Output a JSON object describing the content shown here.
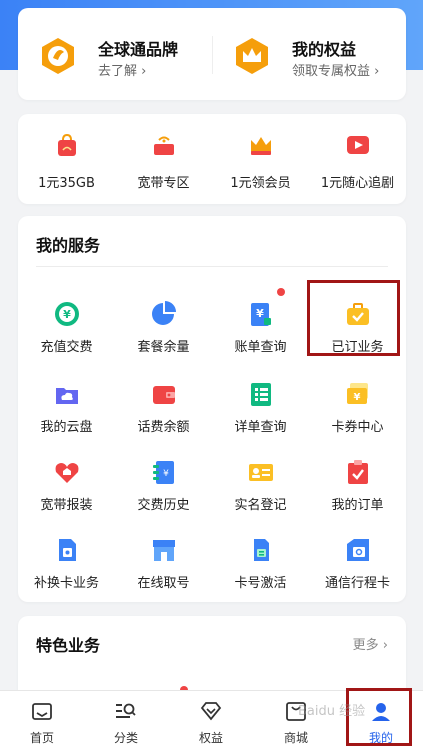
{
  "brand_card": {
    "left": {
      "title": "全球通品牌",
      "subtitle": "去了解 ›",
      "icon": "globe-brand-icon"
    },
    "right": {
      "title": "我的权益",
      "subtitle": "领取专属权益 ›",
      "icon": "crown-icon"
    }
  },
  "promos": [
    {
      "label": "1元35GB",
      "icon": "data-bag-icon"
    },
    {
      "label": "宽带专区",
      "icon": "router-icon"
    },
    {
      "label": "1元领会员",
      "icon": "vip-crown-icon"
    },
    {
      "label": "1元随心追剧",
      "icon": "video-play-icon"
    }
  ],
  "services": {
    "title": "我的服务",
    "items": [
      {
        "label": "充值交费",
        "icon": "yuan-circle-icon"
      },
      {
        "label": "套餐余量",
        "icon": "pie-chart-icon"
      },
      {
        "label": "账单查询",
        "icon": "bill-icon"
      },
      {
        "label": "已订业务",
        "icon": "briefcase-check-icon"
      },
      {
        "label": "我的云盘",
        "icon": "cloud-folder-icon"
      },
      {
        "label": "话费余额",
        "icon": "wallet-icon"
      },
      {
        "label": "详单查询",
        "icon": "list-detail-icon"
      },
      {
        "label": "卡券中心",
        "icon": "coupon-icon"
      },
      {
        "label": "宽带报装",
        "icon": "home-broadband-icon"
      },
      {
        "label": "交费历史",
        "icon": "payment-history-icon"
      },
      {
        "label": "实名登记",
        "icon": "id-card-icon"
      },
      {
        "label": "我的订单",
        "icon": "order-clipboard-icon"
      },
      {
        "label": "补换卡业务",
        "icon": "sim-card-icon"
      },
      {
        "label": "在线取号",
        "icon": "store-icon"
      },
      {
        "label": "卡号激活",
        "icon": "sim-activate-icon"
      },
      {
        "label": "通信行程卡",
        "icon": "travel-card-icon"
      }
    ]
  },
  "featured": {
    "title": "特色业务",
    "more": "更多 ›"
  },
  "bottom_nav": [
    {
      "label": "首页",
      "icon": "home-icon"
    },
    {
      "label": "分类",
      "icon": "category-search-icon"
    },
    {
      "label": "权益",
      "icon": "diamond-icon"
    },
    {
      "label": "商城",
      "icon": "shopping-bag-icon"
    },
    {
      "label": "我的",
      "icon": "user-icon",
      "active": true
    }
  ],
  "watermark": "Baidu 经验",
  "colors": {
    "accent_blue": "#2563eb",
    "highlight_red": "#a11616",
    "orange": "#f59e0b",
    "red": "#ef4444",
    "green": "#10b981"
  }
}
